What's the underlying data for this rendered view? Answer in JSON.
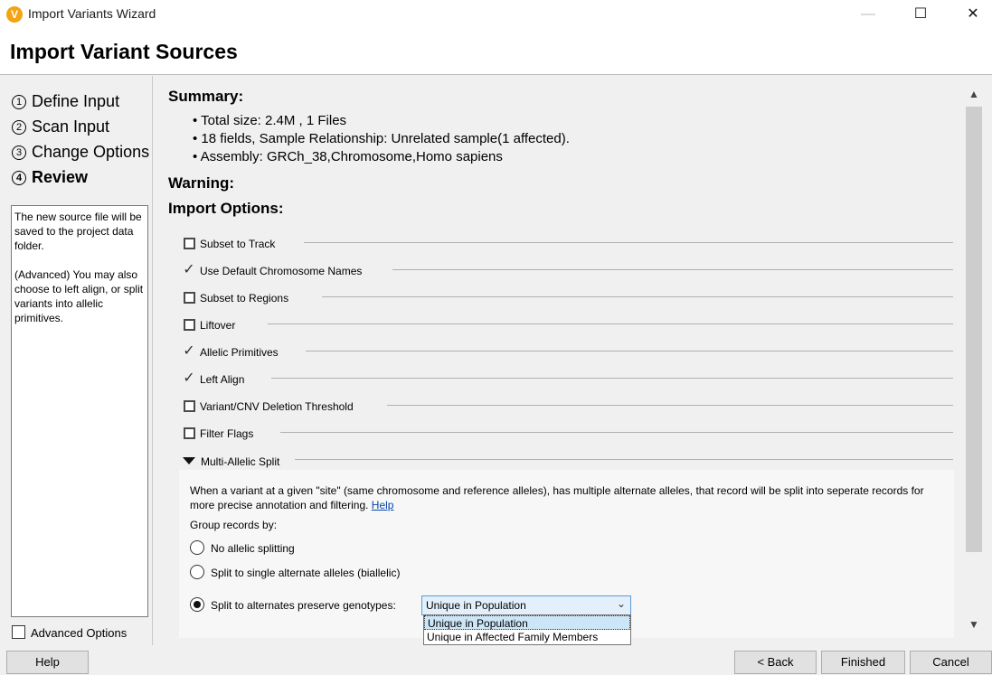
{
  "window": {
    "title": "Import Variants Wizard",
    "min_glyph": "—",
    "max_glyph": "☐",
    "close_glyph": "✕",
    "app_icon_glyph": "V"
  },
  "header": {
    "title": "Import Variant Sources"
  },
  "steps": [
    {
      "num": "1",
      "label": "Define Input"
    },
    {
      "num": "2",
      "label": "Scan Input"
    },
    {
      "num": "3",
      "label": "Change Options"
    },
    {
      "num": "4",
      "label": "Review"
    }
  ],
  "info": {
    "p1": "The new source file will be saved to the project data folder.",
    "p2": "(Advanced) You may also choose to left align, or split variants into allelic primitives."
  },
  "advanced_options": {
    "label": "Advanced Options",
    "checked": false
  },
  "summary": {
    "heading": "Summary:",
    "bullets": [
      "• Total size: 2.4M , 1 Files",
      "• 18 fields, Sample Relationship: Unrelated sample(1 affected).",
      "• Assembly: GRCh_38,Chromosome,Homo sapiens"
    ]
  },
  "warning_heading": "Warning:",
  "import_options": {
    "heading": "Import Options:",
    "items": [
      {
        "label": "Subset to Track",
        "state": "unchecked"
      },
      {
        "label": "Use Default Chromosome Names",
        "state": "checked"
      },
      {
        "label": "Subset to Regions",
        "state": "unchecked"
      },
      {
        "label": "Liftover",
        "state": "unchecked"
      },
      {
        "label": "Allelic Primitives",
        "state": "checked"
      },
      {
        "label": "Left Align",
        "state": "checked"
      },
      {
        "label": "Variant/CNV Deletion Threshold",
        "state": "unchecked"
      },
      {
        "label": "Filter Flags",
        "state": "unchecked"
      }
    ],
    "check_glyph": "✓"
  },
  "multi_allelic": {
    "label": "Multi-Allelic Split",
    "description": "When a variant at a given \"site\" (same chromosome and reference alleles), has multiple alternate alleles, that record will be split into seperate records for more precise annotation and filtering.",
    "help_link": "Help",
    "group_label": "Group records by:",
    "radios": [
      {
        "label": "No allelic splitting",
        "selected": false
      },
      {
        "label": "Split to single alternate alleles (biallelic)",
        "selected": false
      },
      {
        "label": "Split to alternates preserve genotypes:",
        "selected": true
      }
    ],
    "dropdown": {
      "value": "Unique in Population",
      "chevron": "⌄",
      "options": [
        "Unique in Population",
        "Unique in Affected Family Members"
      ]
    }
  },
  "scrollbar": {
    "up": "▲",
    "down": "▼"
  },
  "footer": {
    "help": "Help",
    "back": "< Back",
    "finished": "Finished",
    "cancel": "Cancel"
  }
}
